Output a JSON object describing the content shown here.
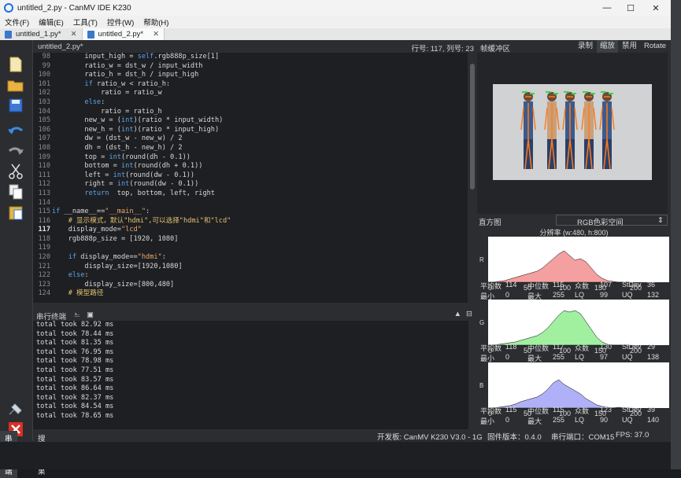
{
  "window": {
    "title": "untitled_2.py - CanMV IDE K230",
    "minimize": "—",
    "maximize": "☐",
    "close": "✕"
  },
  "menu": [
    "文件(F)",
    "编辑(E)",
    "工具(T)",
    "控件(W)",
    "帮助(H)"
  ],
  "tabs": [
    {
      "label": "untitled_1.py*"
    },
    {
      "label": "untitled_2.py*"
    }
  ],
  "toolbar": {
    "icons": [
      "new-file-icon",
      "open-folder-icon",
      "save-icon",
      "undo-icon",
      "redo-icon",
      "cut-icon",
      "copy-icon",
      "paste-icon"
    ],
    "bottom_icons": [
      "connect-icon",
      "stop-icon"
    ]
  },
  "editor": {
    "filename": "untitled_2.py*",
    "cursor_pos": "行号: 117, 列号: 23",
    "lines": [
      {
        "n": "98",
        "t": "        input_high = self.rgb888p_size[1]"
      },
      {
        "n": "99",
        "t": "        ratio_w = dst_w / input_width"
      },
      {
        "n": "100",
        "t": "        ratio_h = dst_h / input_high"
      },
      {
        "n": "101",
        "t": "        if ratio_w < ratio_h:"
      },
      {
        "n": "102",
        "t": "            ratio = ratio_w"
      },
      {
        "n": "103",
        "t": "        else:"
      },
      {
        "n": "104",
        "t": "            ratio = ratio_h"
      },
      {
        "n": "105",
        "t": "        new_w = (int)(ratio * input_width)"
      },
      {
        "n": "106",
        "t": "        new_h = (int)(ratio * input_high)"
      },
      {
        "n": "107",
        "t": "        dw = (dst_w - new_w) / 2"
      },
      {
        "n": "108",
        "t": "        dh = (dst_h - new_h) / 2"
      },
      {
        "n": "109",
        "t": "        top = int(round(dh - 0.1))"
      },
      {
        "n": "110",
        "t": "        bottom = int(round(dh + 0.1))"
      },
      {
        "n": "111",
        "t": "        left = int(round(dw - 0.1))"
      },
      {
        "n": "112",
        "t": "        right = int(round(dw - 0.1))"
      },
      {
        "n": "113",
        "t": "        return  top, bottom, left, right"
      },
      {
        "n": "114",
        "t": ""
      },
      {
        "n": "115",
        "t": "if __name__==\"__main__\":"
      },
      {
        "n": "116",
        "t": "    # 显示模式，默认\"hdmi\",可以选择\"hdmi\"和\"lcd\""
      },
      {
        "n": "117",
        "t": "    display_mode=\"lcd\""
      },
      {
        "n": "118",
        "t": "    rgb888p_size = [1920, 1080]"
      },
      {
        "n": "119",
        "t": ""
      },
      {
        "n": "120",
        "t": "    if display_mode==\"hdmi\":"
      },
      {
        "n": "121",
        "t": "        display_size=[1920,1080]"
      },
      {
        "n": "122",
        "t": "    else:"
      },
      {
        "n": "123",
        "t": "        display_size=[800,480]"
      },
      {
        "n": "124",
        "t": "    # 模型路径"
      }
    ]
  },
  "serial": {
    "title": "串行终端",
    "lines": [
      "total took 82.92 ms",
      "total took 78.44 ms",
      "total took 81.35 ms",
      "total took 76.95 ms",
      "total took 78.98 ms",
      "total took 77.51 ms",
      "total took 83.57 ms",
      "total took 86.64 ms",
      "total took 82.37 ms",
      "total took 84.54 ms",
      "total took 78.65 ms"
    ]
  },
  "bottom_tabs": [
    "搜索结果",
    "串行终端"
  ],
  "framebuffer": {
    "title": "帧缓冲区",
    "buttons": [
      "录制",
      "缩放",
      "禁用",
      "Rotate"
    ],
    "active": "缩放"
  },
  "histogram": {
    "title": "直方图",
    "colorspace": "RGB色彩空间",
    "resolution": "分辨率 (w:480, h:800)",
    "ticks": [
      "0",
      "50",
      "100",
      "150",
      "200"
    ],
    "channels": [
      {
        "label": "R",
        "color": "#f4a0a0",
        "stats": {
          "平均数": "114",
          "中位数": "115",
          "众数": "107",
          "StDev": "36",
          "最小": "0",
          "最大": "255",
          "LQ": "99",
          "UQ": "132"
        }
      },
      {
        "label": "G",
        "color": "#a0f0a0",
        "stats": {
          "平均数": "118",
          "中位数": "117",
          "众数": "130",
          "StDev": "29",
          "最小": "0",
          "最大": "255",
          "LQ": "97",
          "UQ": "138"
        }
      },
      {
        "label": "B",
        "color": "#b0b0f8",
        "stats": {
          "平均数": "115",
          "中位数": "115",
          "众数": "123",
          "StDev": "39",
          "最小": "0",
          "最大": "255",
          "LQ": "90",
          "UQ": "140"
        }
      }
    ]
  },
  "status": {
    "board": "开发板: CanMV K230 V3.0 - 1G",
    "firmware": "固件版本：0.4.0",
    "port": "串行端口：COM15",
    "fps": "FPS:  37.0"
  }
}
